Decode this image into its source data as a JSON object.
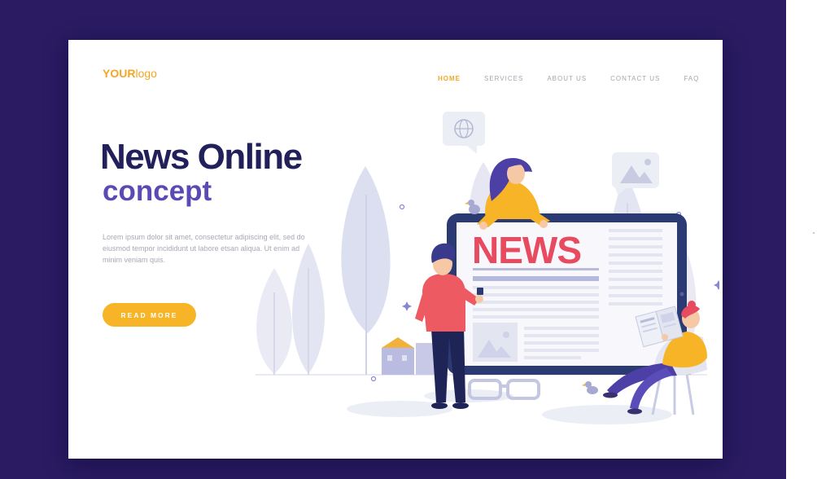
{
  "header": {
    "logo_bold": "YOUR",
    "logo_light": "logo",
    "nav": [
      {
        "label": "HOME",
        "active": true
      },
      {
        "label": "SERVICES",
        "active": false
      },
      {
        "label": "ABOUT US",
        "active": false
      },
      {
        "label": "CONTACT US",
        "active": false
      },
      {
        "label": "FAQ",
        "active": false
      }
    ]
  },
  "hero": {
    "title": "News Online",
    "subtitle": "concept",
    "description": "Lorem ipsum dolor sit amet, consectetur adipiscing elit, sed do eiusmod tempor incididunt ut labore etsan aliqua. Ut enim ad minim veniam quis.",
    "button_label": "READ MORE"
  },
  "illustration": {
    "screen_headline": "NEWS"
  },
  "colors": {
    "background": "#2a1b63",
    "accent": "#f5a623",
    "title": "#22205a",
    "subtitle": "#5b4ab3",
    "news_red": "#e84a5f"
  }
}
